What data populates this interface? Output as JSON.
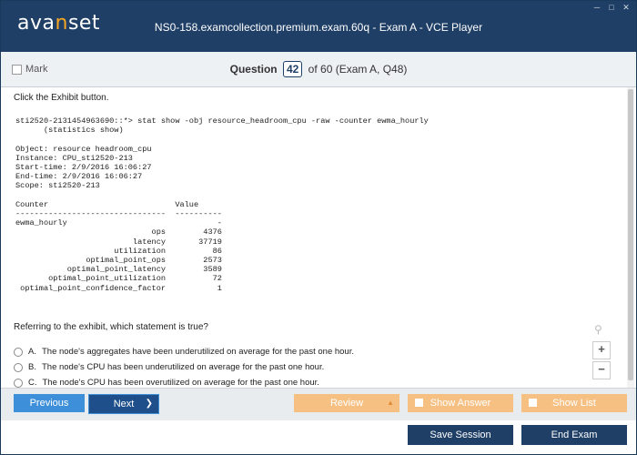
{
  "titlebar": {
    "logo_pre": "ava",
    "logo_accent": "n",
    "logo_post": "set",
    "title": "NS0-158.examcollection.premium.exam.60q - Exam A - VCE Player"
  },
  "header": {
    "mark_label": "Mark",
    "question_label": "Question",
    "question_number": "42",
    "question_of": "of 60 (Exam A, Q48)"
  },
  "content": {
    "instruction": "Click the Exhibit button.",
    "exhibit": "sti2520-2131454963690::*> stat show -obj resource_headroom_cpu -raw -counter ewma_hourly\n      (statistics show)\n\nObject: resource headroom_cpu\nInstance: CPU_sti2520-213\nStart-time: 2/9/2016 16:06:27\nEnd-time: 2/9/2016 16:06:27\nScope: sti2520-213\n\nCounter                           Value\n--------------------------------  ----------\newma_hourly                                -\n                             ops        4376\n                         latency       37719\n                     utilization          86\n               optimal_point_ops        2573\n           optimal_point_latency        3589\n       optimal_point_utilization          72\n optimal_point_confidence_factor           1",
    "prompt": "Referring to the exhibit, which statement is true?",
    "options": [
      {
        "letter": "A.",
        "text": "The node's aggregates have been underutilized on average for the past one hour."
      },
      {
        "letter": "B.",
        "text": "The node's CPU has been underutilized on average for the past one hour."
      },
      {
        "letter": "C.",
        "text": "The node's CPU has been overutilized on average for the past one hour."
      }
    ]
  },
  "zoom": {
    "plus": "+",
    "minus": "−"
  },
  "nav": {
    "previous": "Previous",
    "next": "Next",
    "review": "Review",
    "show_answer": "Show Answer",
    "show_list": "Show List",
    "save_session": "Save Session",
    "end_exam": "End Exam"
  }
}
